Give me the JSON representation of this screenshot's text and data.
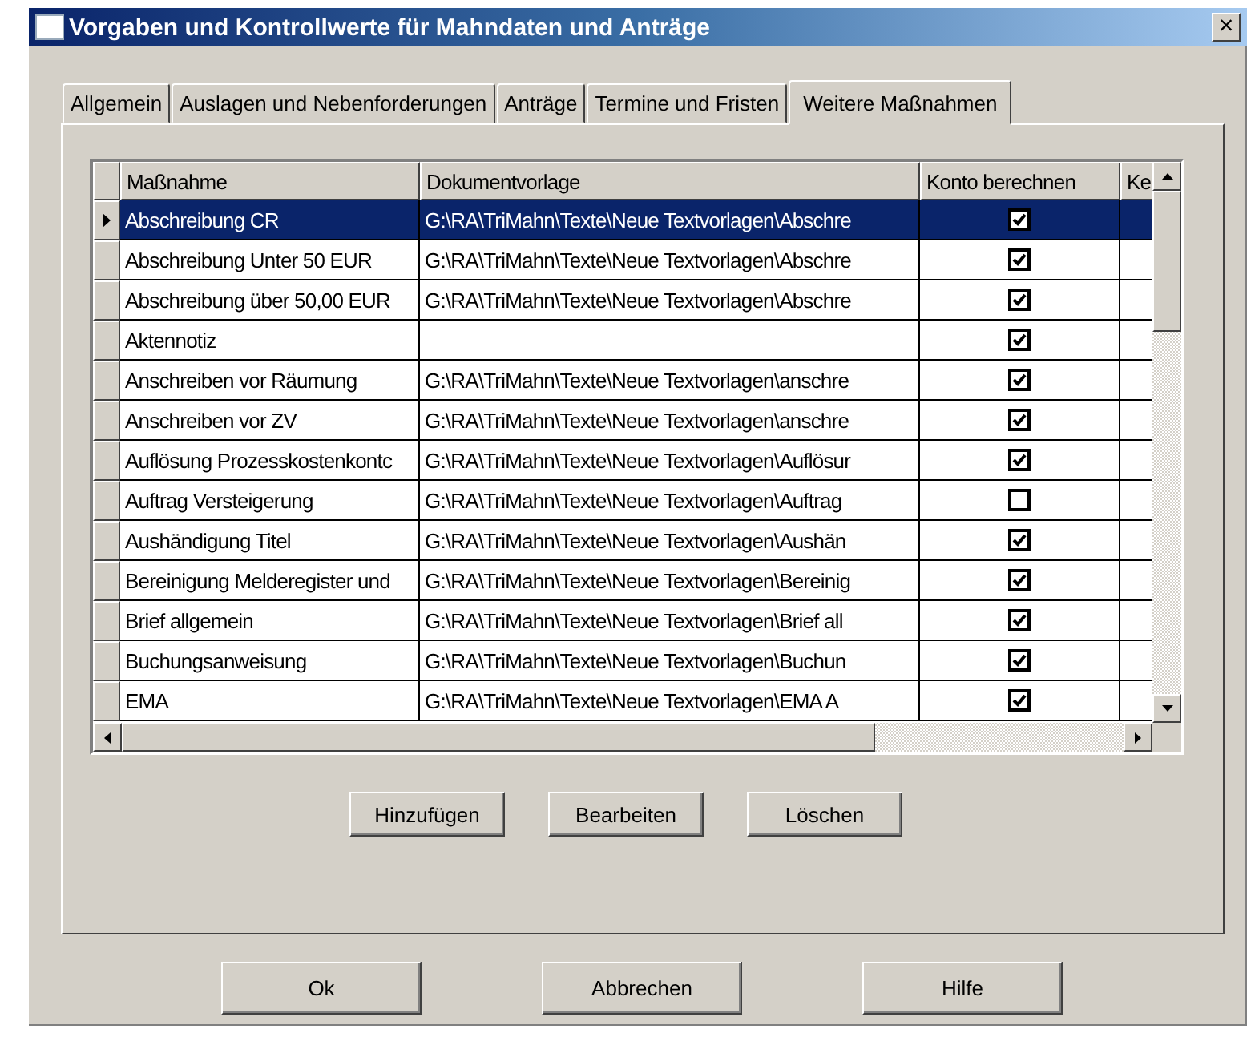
{
  "window": {
    "title": "Vorgaben und Kontrollwerte für Mahndaten und Anträge",
    "close": "×"
  },
  "tabs": [
    {
      "label": "Allgemein",
      "selected": false
    },
    {
      "label": "Auslagen und Nebenforderungen",
      "selected": false
    },
    {
      "label": "Anträge",
      "selected": false
    },
    {
      "label": "Termine und Fristen",
      "selected": false
    },
    {
      "label": "Weitere Maßnahmen",
      "selected": true
    }
  ],
  "table": {
    "columns": [
      "Maßnahme",
      "Dokumentvorlage",
      "Konto berechnen",
      "Ke"
    ],
    "rows": [
      {
        "measure": "Abschreibung CR",
        "template": "G:\\RA\\TriMahn\\Texte\\Neue Textvorlagen\\Abschre",
        "checked": true,
        "selected": true
      },
      {
        "measure": "Abschreibung Unter 50 EUR",
        "template": "G:\\RA\\TriMahn\\Texte\\Neue Textvorlagen\\Abschre",
        "checked": true,
        "selected": false
      },
      {
        "measure": "Abschreibung über 50,00 EUR",
        "template": "G:\\RA\\TriMahn\\Texte\\Neue Textvorlagen\\Abschre",
        "checked": true,
        "selected": false
      },
      {
        "measure": "Aktennotiz",
        "checked": true,
        "selected": false
      },
      {
        "measure": "Anschreiben vor Räumung",
        "template": "G:\\RA\\TriMahn\\Texte\\Neue Textvorlagen\\anschre",
        "checked": true,
        "selected": false
      },
      {
        "measure": "Anschreiben vor ZV",
        "template": "G:\\RA\\TriMahn\\Texte\\Neue Textvorlagen\\anschre",
        "checked": true,
        "selected": false
      },
      {
        "measure": "Auflösung Prozesskostenkontc",
        "template": "G:\\RA\\TriMahn\\Texte\\Neue Textvorlagen\\Auflösur",
        "checked": true,
        "selected": false
      },
      {
        "measure": "Auftrag Versteigerung",
        "template": "G:\\RA\\TriMahn\\Texte\\Neue Textvorlagen\\Auftrag",
        "checked": false,
        "selected": false
      },
      {
        "measure": "Aushändigung Titel",
        "template": "G:\\RA\\TriMahn\\Texte\\Neue Textvorlagen\\Aushän",
        "checked": true,
        "selected": false
      },
      {
        "measure": "Bereinigung Melderegister und",
        "template": "G:\\RA\\TriMahn\\Texte\\Neue Textvorlagen\\Bereinig",
        "checked": true,
        "selected": false
      },
      {
        "measure": "Brief allgemein",
        "template": "G:\\RA\\TriMahn\\Texte\\Neue Textvorlagen\\Brief all",
        "checked": true,
        "selected": false
      },
      {
        "measure": "Buchungsanweisung",
        "template": "G:\\RA\\TriMahn\\Texte\\Neue Textvorlagen\\Buchun",
        "checked": true,
        "selected": false
      },
      {
        "measure": "EMA",
        "template": "G:\\RA\\TriMahn\\Texte\\Neue Textvorlagen\\EMA A",
        "checked": true,
        "selected": false
      }
    ]
  },
  "table_buttons": [
    "Hinzufügen",
    "Bearbeiten",
    "Löschen"
  ],
  "buttons": [
    "Ok",
    "Abbrechen",
    "Hilfe"
  ]
}
